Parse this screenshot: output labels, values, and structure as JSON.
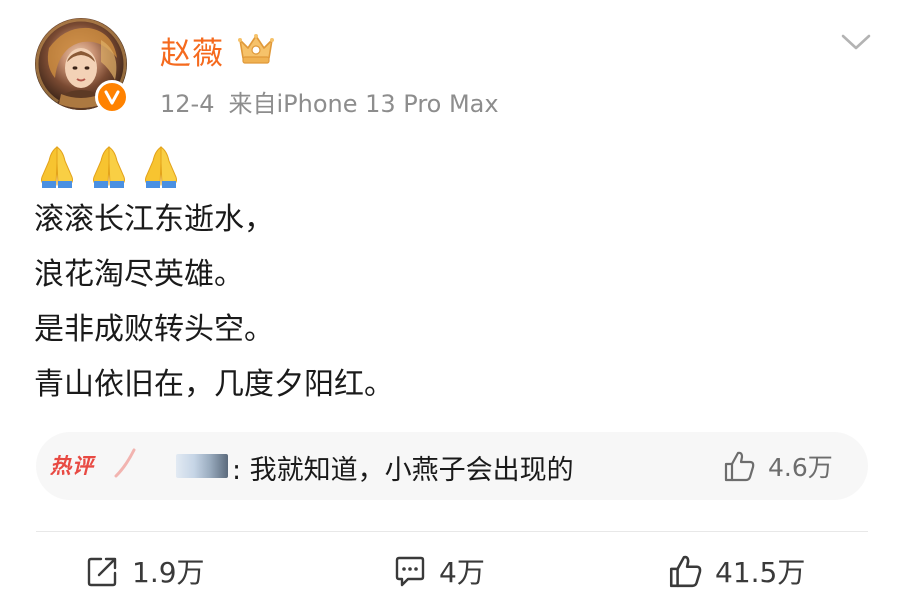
{
  "post": {
    "user_name": "赵薇",
    "date": "12-4",
    "source": "来自iPhone 13 Pro Max",
    "emoji": [
      "🙏",
      "🙏",
      "🙏"
    ],
    "body_lines": [
      "滚滚长江东逝水，",
      "浪花淘尽英雄。",
      "是非成败转头空。",
      "青山依旧在，几度夕阳红。"
    ],
    "hot_comment": {
      "label": "热评",
      "text": ": 我就知道，小燕子会出现的",
      "like_count": "4.6万"
    },
    "actions": {
      "repost_count": "1.9万",
      "comment_count": "4万",
      "like_count": "41.5万"
    }
  },
  "colors": {
    "name": "#f56a1e",
    "meta": "#8d8d8d",
    "hot_label": "#e84a43",
    "verified": "#ff8200",
    "comment_bg": "#f7f7f7"
  },
  "icons": {
    "verified": "verified-badge-icon",
    "crown": "crown-badge-icon",
    "chevron": "chevron-down-icon",
    "pray": "folded-hands-emoji",
    "repost": "repost-icon",
    "comment": "comment-icon",
    "like": "thumbs-up-icon"
  }
}
